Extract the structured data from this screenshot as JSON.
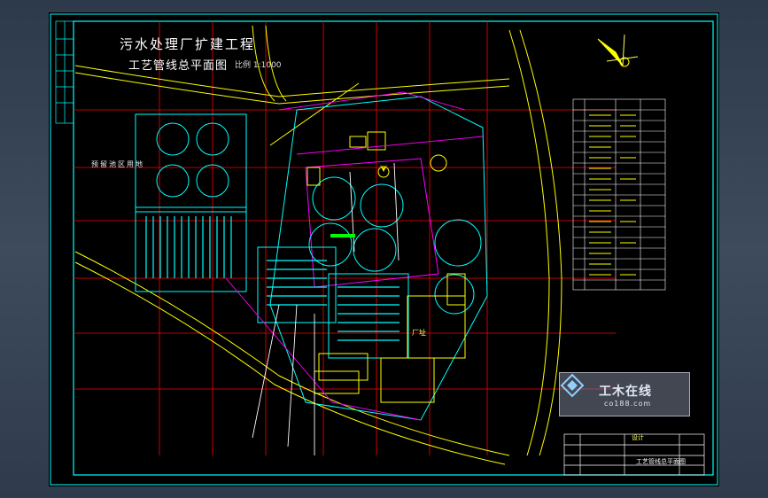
{
  "drawing": {
    "title_line1": "污水处理厂扩建工程",
    "title_line2": "工艺管线总平面图",
    "scale_text": "比例 1:1000",
    "zone_label": "预留池区用地",
    "plant_label": "厂址"
  },
  "title_block": {
    "drawing_name": "工艺管线总平面图",
    "field_a": "设计"
  },
  "watermark": {
    "brand": "工木在线",
    "url": "co188.com"
  },
  "colors": {
    "frame": "#00ffff",
    "grid": "#ff0000",
    "roads": "#ffff00",
    "structures": "#00ffff",
    "pipes": "#ff00ff",
    "background": "#000000"
  }
}
